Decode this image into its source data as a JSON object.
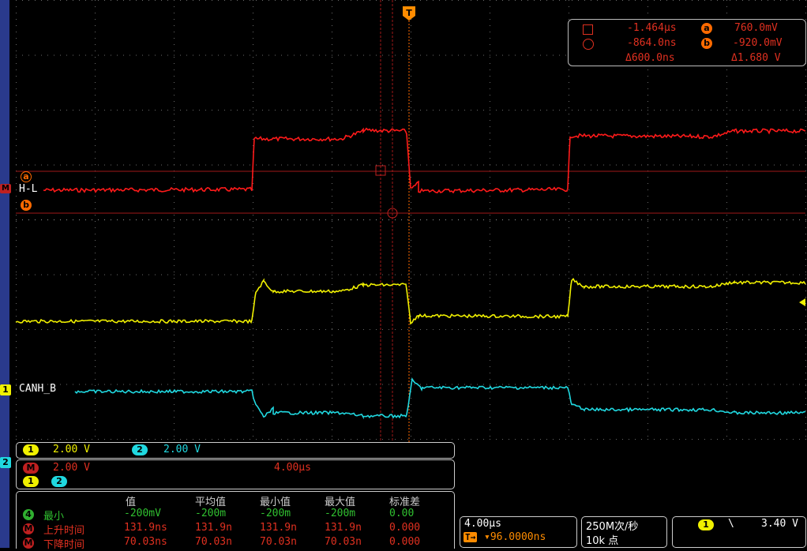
{
  "colors": {
    "ch_math": "#ff2020",
    "ch1": "#f0f000",
    "ch2": "#20d8e0",
    "cursor": "#c02020",
    "grid": "#888888",
    "orange": "#ff6a00"
  },
  "trigger_marker": "T",
  "cursor_labels": {
    "a": "a",
    "b": "b",
    "math": "M"
  },
  "traces": {
    "math_label": "H-L",
    "ch1_label": "CANH_B",
    "ch1_marker": "1",
    "ch2_marker": "2"
  },
  "cursor_readout": {
    "row1": {
      "time": "-1.464μs",
      "a_marker": "a",
      "a_value": "760.0mV"
    },
    "row2": {
      "time": "-864.0ns",
      "b_marker": "b",
      "b_value": "-920.0mV"
    },
    "row3": {
      "dt": "Δ600.0ns",
      "dv": "Δ1.680 V"
    }
  },
  "channel_panel": {
    "ch1_marker": "1",
    "ch1_scale": "2.00 V",
    "ch2_marker": "2",
    "ch2_scale": "2.00 V"
  },
  "math_panel": {
    "marker": "M",
    "scale": "2.00 V",
    "time": "4.00μs",
    "src1": "1",
    "src2": "2"
  },
  "measurements": {
    "headers": [
      "值",
      "平均值",
      "最小值",
      "最大值",
      "标准差"
    ],
    "rows": [
      {
        "marker": "4",
        "name": "最小",
        "values": [
          "-200mV",
          "-200m",
          "-200m",
          "-200m",
          "0.00"
        ]
      },
      {
        "marker": "M",
        "name": "上升时间",
        "values": [
          "131.9ns",
          "131.9n",
          "131.9n",
          "131.9n",
          "0.000"
        ]
      },
      {
        "marker": "M",
        "name": "下降时间",
        "values": [
          "70.03ns",
          "70.03n",
          "70.03n",
          "70.03n",
          "0.000"
        ]
      }
    ]
  },
  "timebase": {
    "scale": "4.00μs",
    "trigger_pos": "▾96.0000ns",
    "trigger_icon": "T→"
  },
  "acquisition": {
    "rate": "250M次/秒",
    "points": "10k 点"
  },
  "trigger": {
    "source": "1",
    "slope": "\\",
    "level": "3.40 V"
  }
}
